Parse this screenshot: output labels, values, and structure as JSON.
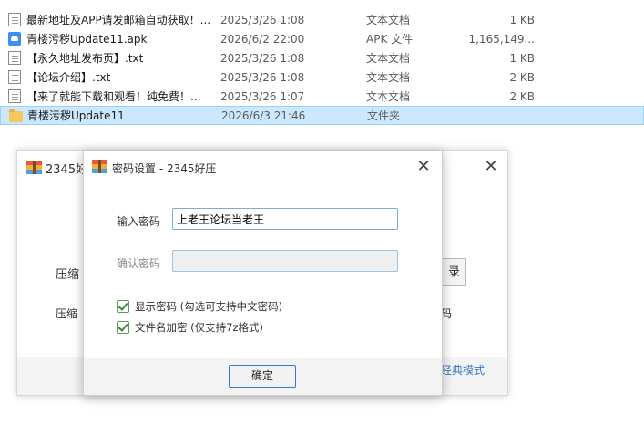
{
  "files": [
    {
      "name": "最新地址及APP请发邮箱自动获取！...",
      "date": "2025/3/26 1:08",
      "type": "文本文档",
      "size": "1 KB",
      "icon": "text-file-icon"
    },
    {
      "name": "青楼污秽Update11.apk",
      "date": "2026/6/2 22:00",
      "type": "APK 文件",
      "size": "1,165,149...",
      "icon": "apk-file-icon"
    },
    {
      "name": "【永久地址发布页】.txt",
      "date": "2025/3/26 1:08",
      "type": "文本文档",
      "size": "1 KB",
      "icon": "text-file-icon"
    },
    {
      "name": "【论坛介绍】.txt",
      "date": "2025/3/26 1:08",
      "type": "文本文档",
      "size": "2 KB",
      "icon": "text-file-icon"
    },
    {
      "name": "【来了就能下载和观看！纯免费！...",
      "date": "2025/3/26 1:07",
      "type": "文本文档",
      "size": "2 KB",
      "icon": "text-file-icon"
    },
    {
      "name": "青楼污秽Update11",
      "date": "2026/6/3 21:46",
      "type": "文件夹",
      "size": "",
      "icon": "folder-icon",
      "selected": true
    }
  ],
  "bg_window": {
    "title": "2345好",
    "label_1": "压缩",
    "label_2": "压缩",
    "button_text": "录",
    "right_text": "码",
    "footer_link": "经典模式"
  },
  "dialog": {
    "title": "密码设置 - 2345好压",
    "password_label": "输入密码",
    "password_value": "上老王论坛当老王",
    "confirm_label": "确认密码",
    "confirm_value": "",
    "show_password_label": "显示密码 (勾选可支持中文密码)",
    "encrypt_names_label": "文件名加密  (仅支持7z格式)",
    "ok_label": "确定",
    "close_glyph": "✕"
  },
  "colors": {
    "selection_bg": "#cce8ff",
    "input_border": "#7aaed6",
    "link": "#3a74c2",
    "checkbox": "#3a8a3a"
  }
}
